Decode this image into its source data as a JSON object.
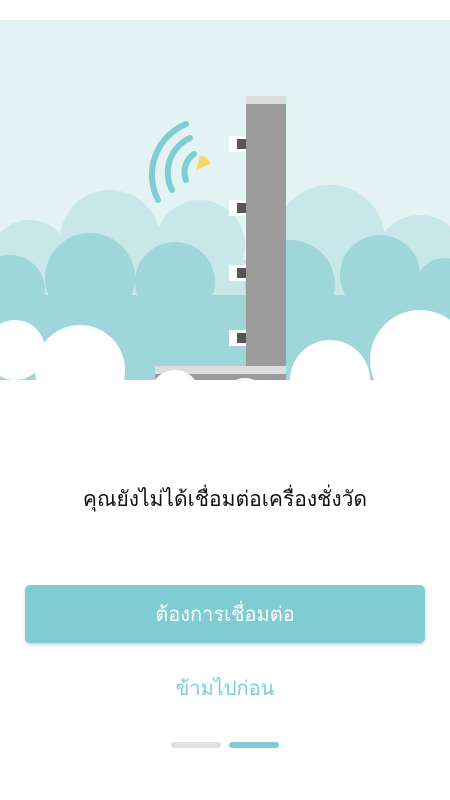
{
  "onboarding": {
    "message": "คุณยังไม่ได้เชื่อมต่อเครื่องชั่งวัด",
    "primary_button_label": "ต้องการเชื่อมต่อ",
    "skip_label": "ข้ามไปก่อน",
    "pager": {
      "total_pages": 2,
      "active_page": 2
    }
  },
  "illustration": {
    "icons": [
      "wifi-signal-icon",
      "scale-device-icon"
    ]
  },
  "colors": {
    "accent": "#7fcdd2",
    "sky": "#e3f2f2",
    "cloud_back": "#c8e7e8",
    "cloud_mid": "#9fd6da",
    "device": "#9b9b9b",
    "signal_dot": "#f5d565",
    "pager_inactive": "#e2e2e2"
  }
}
